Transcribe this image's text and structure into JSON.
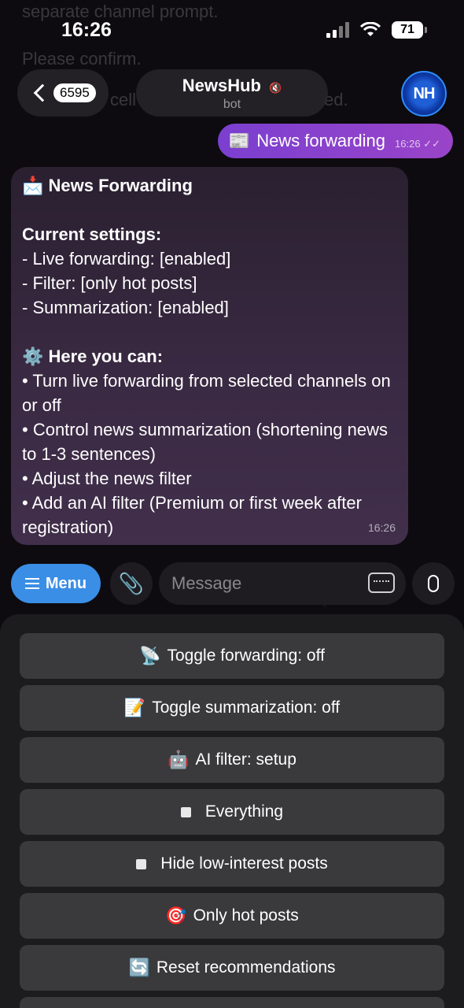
{
  "status": {
    "time": "16:26",
    "battery": "71"
  },
  "ghost": {
    "line1": "separate channel prompt.",
    "line2": "Please confirm.",
    "line3": "cell",
    "line4": "ed."
  },
  "header": {
    "back_count": "6595",
    "title": "NewsHub",
    "subtitle": "bot",
    "avatar_text": "NH"
  },
  "outgoing": {
    "icon": "📰",
    "text": "News forwarding",
    "time": "16:26"
  },
  "incoming": {
    "title_icon": "📩",
    "title": "News Forwarding",
    "settings_heading": "Current settings:",
    "settings": [
      "- Live forwarding: [enabled]",
      "- Filter: [only hot posts]",
      "- Summarization: [enabled]"
    ],
    "can_icon": "⚙️",
    "can_heading": "Here you can:",
    "can_items": [
      "• Turn live forwarding from selected channels on or off",
      "• Control news summarization (shortening news to 1-3 sentences)",
      "• Adjust the news filter",
      "• Add an AI filter (Premium or first week after registration)"
    ],
    "time": "16:26"
  },
  "input": {
    "menu_label": "Menu",
    "placeholder": "Message"
  },
  "keyboard": [
    {
      "emoji": "📡",
      "label": "Toggle forwarding: off"
    },
    {
      "emoji": "📝",
      "label": "Toggle summarization: off"
    },
    {
      "emoji": "🤖",
      "label": "AI filter: setup"
    },
    {
      "emoji": "",
      "label": "Everything"
    },
    {
      "emoji": "",
      "label": "Hide low-interest posts"
    },
    {
      "emoji": "🎯",
      "label": "Only hot posts"
    },
    {
      "emoji": "🔄",
      "label": "Reset recommendations"
    }
  ],
  "colors": {
    "accent": "#3a8ee6",
    "outgoing_bubble": "#8a42cc"
  }
}
